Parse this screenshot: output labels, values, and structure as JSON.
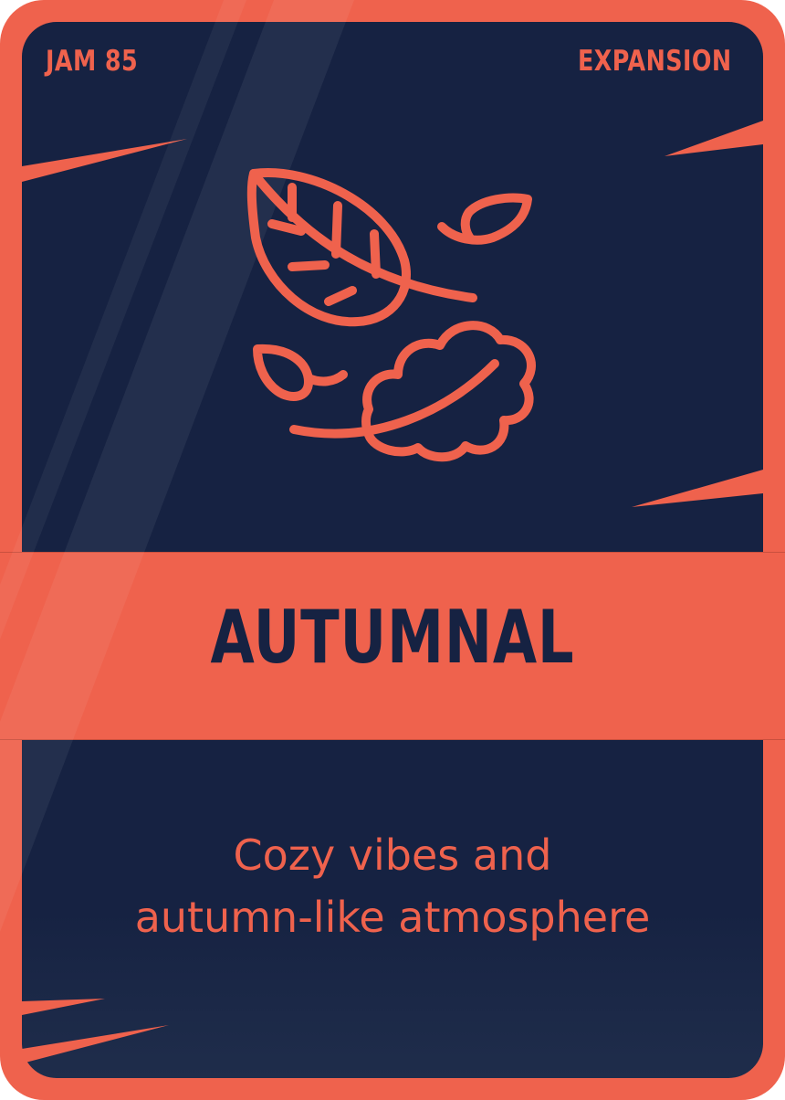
{
  "card": {
    "jam_label": "JAM 85",
    "category": "EXPANSION",
    "title": "AUTUMNAL",
    "description_lines": [
      "Cozy vibes and",
      "autumn-like atmosphere"
    ]
  },
  "icon": "falling-leaves-icon",
  "colors": {
    "accent": "#ef624d",
    "background": "#162242",
    "title_text": "#162242"
  }
}
